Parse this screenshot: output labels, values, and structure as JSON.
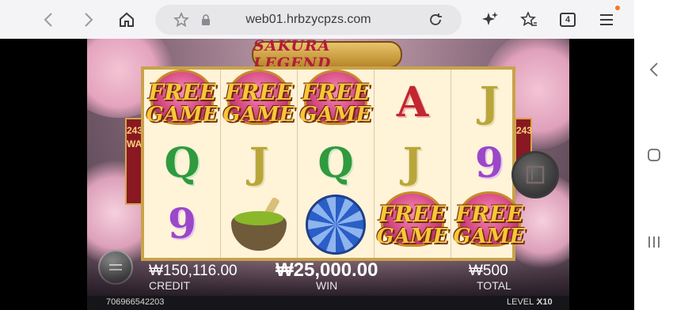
{
  "browser": {
    "url": "web01.hrbzycpzs.com",
    "tab_count": "4",
    "icons": [
      "back-arrow-icon",
      "forward-arrow-icon",
      "home-icon",
      "star-icon",
      "lock-icon",
      "reload-icon",
      "sparkle-icon",
      "bookmarks-icon",
      "tabs-icon",
      "menu-icon"
    ]
  },
  "game": {
    "logo": "SAKURA LEGEND",
    "ways_left": "243 WAYS",
    "ways_right": "243",
    "free_line1": "FREE",
    "free_line2": "GAME",
    "letters": {
      "q": "Q",
      "j": "J",
      "a": "A",
      "nine": "9"
    }
  },
  "hud": {
    "credit_value": "₩150,116.00",
    "credit_label": "CREDIT",
    "win_value": "₩25,000.00",
    "win_label": "WIN",
    "total_value": "₩500",
    "total_label": "TOTAL"
  },
  "footer": {
    "id": "706966542203",
    "level_label": "LEVEL :",
    "level_value": "X10"
  },
  "colors": {
    "browser_bg": "#f4f4f6",
    "reel_frame": "#c9a24a",
    "free_text": "#f9c63a"
  }
}
